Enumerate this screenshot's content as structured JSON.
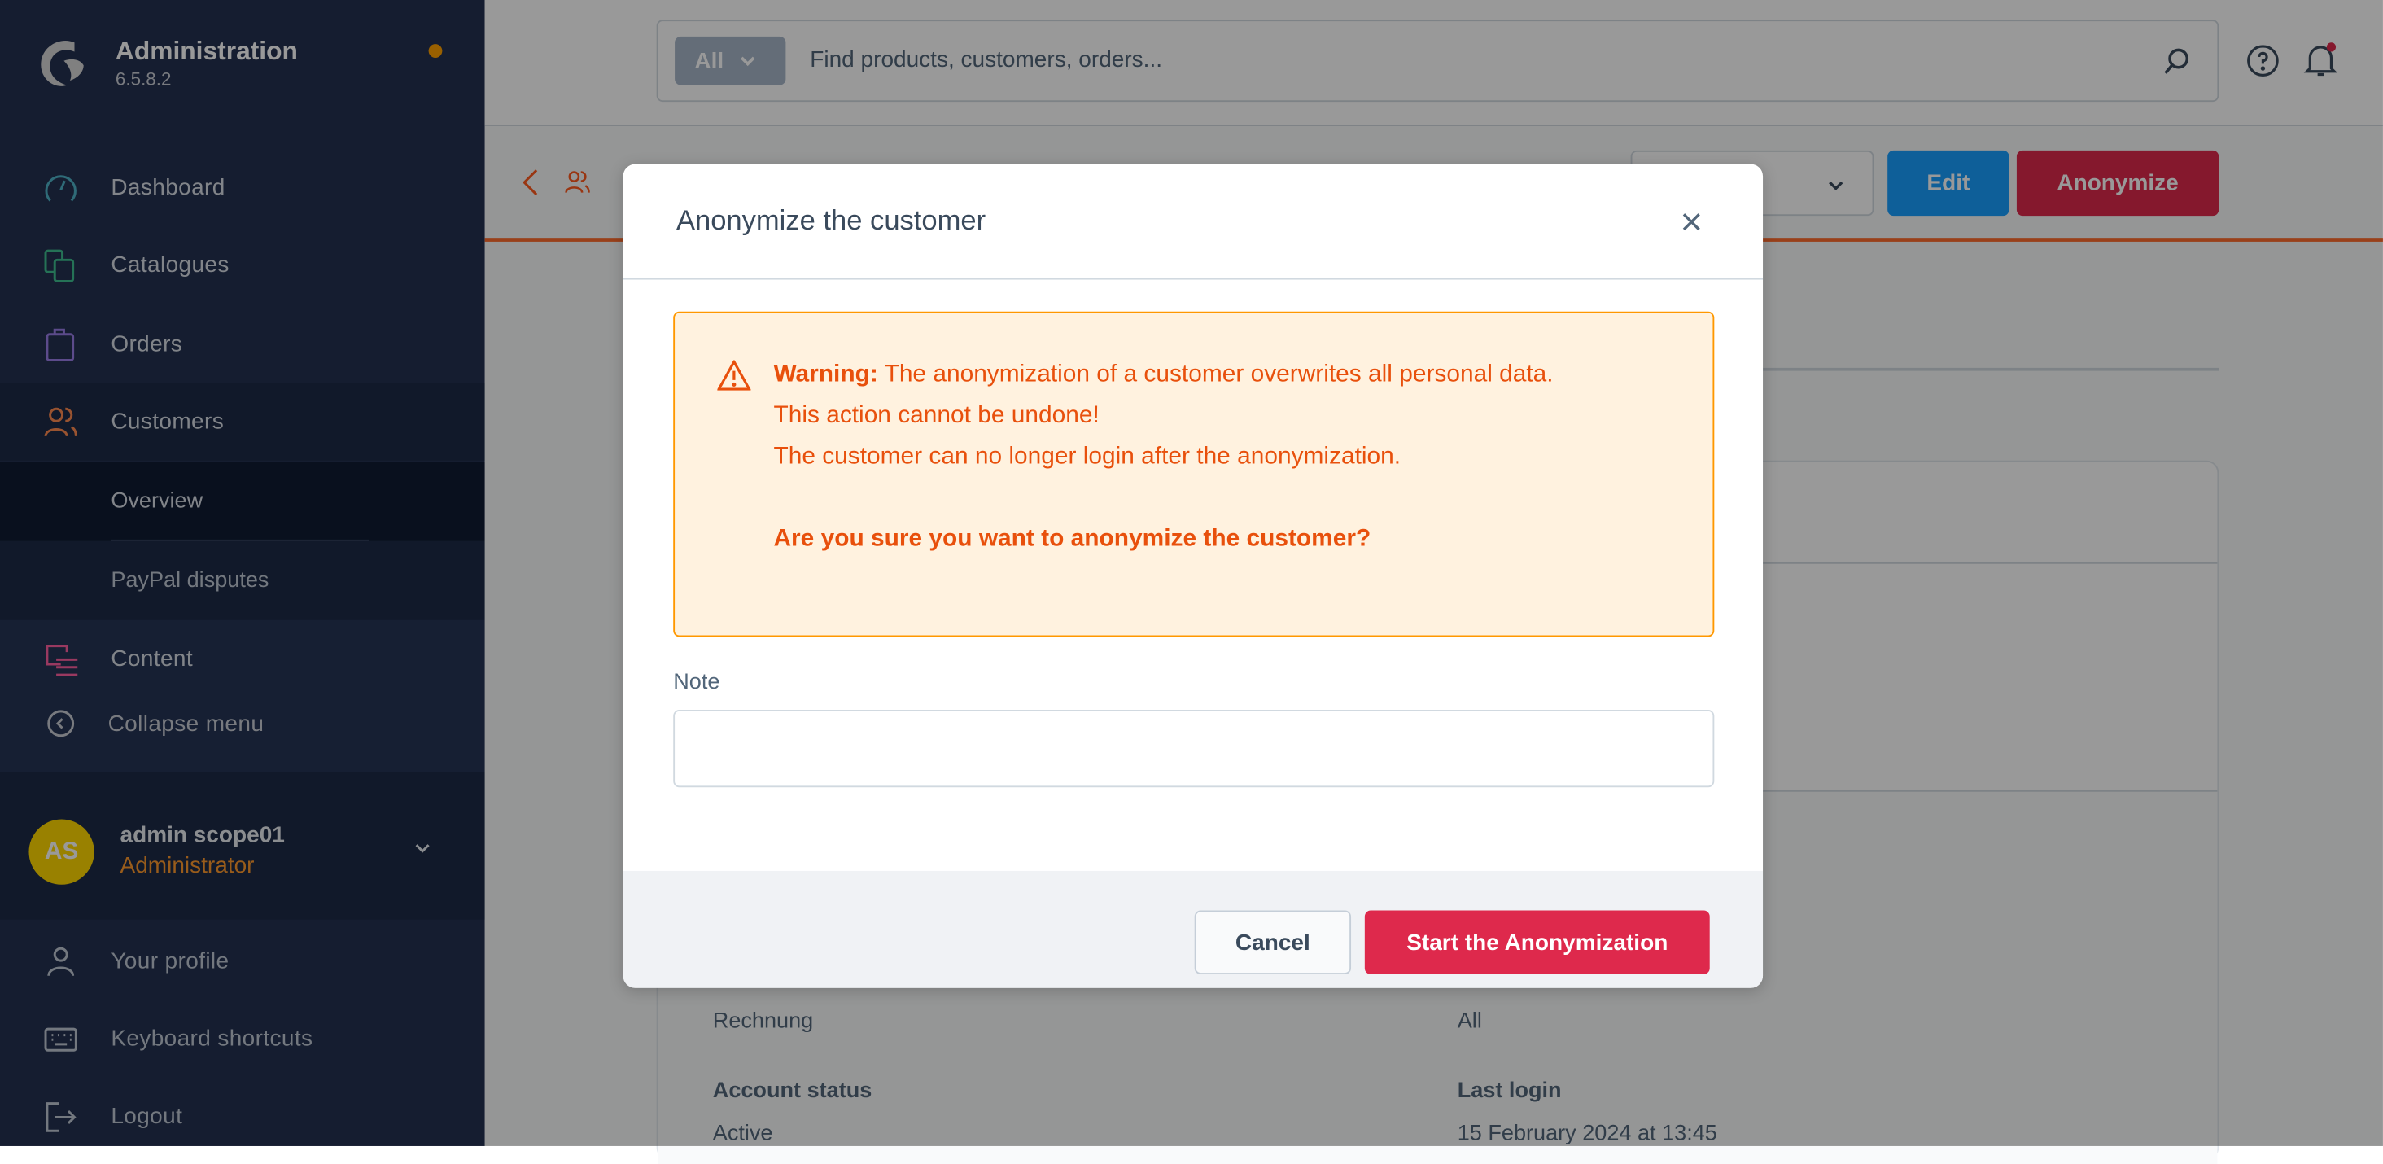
{
  "app": {
    "title": "Administration",
    "version": "6.5.8.2"
  },
  "colors": {
    "sidebar": "#233150",
    "primary": "#189eff",
    "danger": "#de294c",
    "warning_bg": "#fff2df",
    "warning_text": "#e8500c",
    "avatar": "#ffd700"
  },
  "sidebar": {
    "items": [
      {
        "label": "Dashboard",
        "icon": "gauge-icon"
      },
      {
        "label": "Catalogues",
        "icon": "catalogue-icon"
      },
      {
        "label": "Orders",
        "icon": "shopping-bag-icon"
      },
      {
        "label": "Customers",
        "icon": "users-icon"
      },
      {
        "label": "Content",
        "icon": "content-icon"
      }
    ],
    "sub_items": [
      {
        "label": "Overview",
        "active": true
      },
      {
        "label": "PayPal disputes"
      }
    ],
    "collapse": "Collapse menu",
    "user": {
      "initials": "AS",
      "name": "admin scope01",
      "role": "Administrator"
    },
    "user_menu": [
      {
        "label": "Your profile"
      },
      {
        "label": "Keyboard shortcuts"
      },
      {
        "label": "Logout"
      }
    ]
  },
  "header": {
    "search_type": "All",
    "search_placeholder": "Find products, customers, orders..."
  },
  "smartbar": {
    "edit": "Edit",
    "anonymize": "Anonymize"
  },
  "details": [
    {
      "label": "",
      "value": "Rechnung"
    },
    {
      "label": "",
      "value": "All"
    },
    {
      "label": "Account status",
      "value": "Active"
    },
    {
      "label": "Last login",
      "value": "15 February 2024 at 13:45"
    }
  ],
  "modal": {
    "title": "Anonymize the customer",
    "warning_label": "Warning:",
    "warning_text": " The anonymization of a customer overwrites all personal data.",
    "line2": "This action cannot be undone!",
    "line3": "The customer can no longer login after the anonymization.",
    "question": "Are you sure you want to anonymize the customer?",
    "note_label": "Note",
    "note_value": "",
    "cancel": "Cancel",
    "confirm": "Start the Anonymization"
  }
}
